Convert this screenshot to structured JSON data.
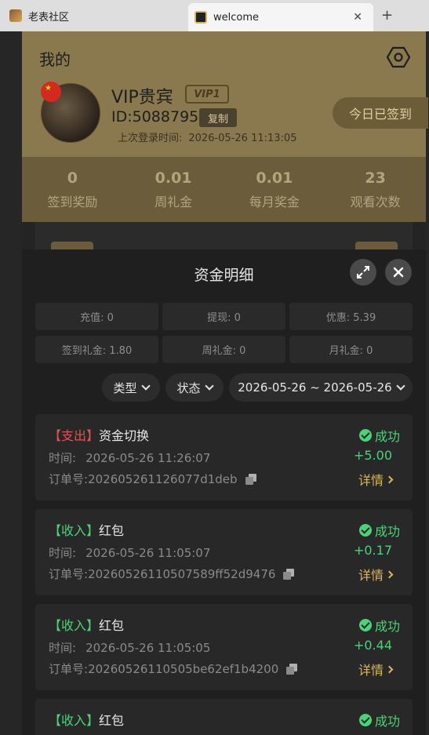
{
  "browser": {
    "tabs": [
      {
        "title": "老表社区"
      },
      {
        "title": "welcome"
      }
    ],
    "close_glyph": "✕",
    "new_tab_glyph": "+"
  },
  "profile": {
    "page_title": "我的",
    "name": "VIP贵宾",
    "vip_badge": "VIP1",
    "user_id": "ID:5088795",
    "copy_label": "复制",
    "last_login_label": "上次登录时间:",
    "last_login_time": "2026-05-26 11:13:05",
    "signin_label": "今日已签到",
    "accent_color": "#8a784e"
  },
  "stats": [
    {
      "value": "0",
      "label": "签到奖励"
    },
    {
      "value": "0.01",
      "label": "周礼金"
    },
    {
      "value": "0.01",
      "label": "每月奖金"
    },
    {
      "value": "23",
      "label": "观看次数"
    }
  ],
  "sheet": {
    "title": "资金明细",
    "summary": [
      "充值: 0",
      "提现: 0",
      "优惠: 5.39",
      "签到礼金: 1.80",
      "周礼金: 0",
      "月礼金: 0"
    ],
    "filters": {
      "type": "类型",
      "status": "状态",
      "date_range": "2026-05-26 ~ 2026-05-26"
    }
  },
  "records": [
    {
      "tag": "【支出】",
      "tag_kind": "out",
      "title": "资金切换",
      "time_label": "时间:",
      "time": "2026-05-26 11:26:07",
      "order_label": "订单号:",
      "order_no": "202605261126077d1deb",
      "status": "成功",
      "amount": "+5.00",
      "detail_label": "详情"
    },
    {
      "tag": "【收入】",
      "tag_kind": "in",
      "title": "红包",
      "time_label": "时间:",
      "time": "2026-05-26 11:05:07",
      "order_label": "订单号:",
      "order_no": "20260526110507589ff52d9476",
      "status": "成功",
      "amount": "+0.17",
      "detail_label": "详情"
    },
    {
      "tag": "【收入】",
      "tag_kind": "in",
      "title": "红包",
      "time_label": "时间:",
      "time": "2026-05-26 11:05:05",
      "order_label": "订单号:",
      "order_no": "20260526110505be62ef1b4200",
      "status": "成功",
      "amount": "+0.44",
      "detail_label": "详情"
    },
    {
      "tag": "【收入】",
      "tag_kind": "in",
      "title": "红包",
      "status": "成功"
    }
  ],
  "colors": {
    "success": "#4cd37a",
    "expense": "#e05454",
    "gold": "#d9b560"
  }
}
